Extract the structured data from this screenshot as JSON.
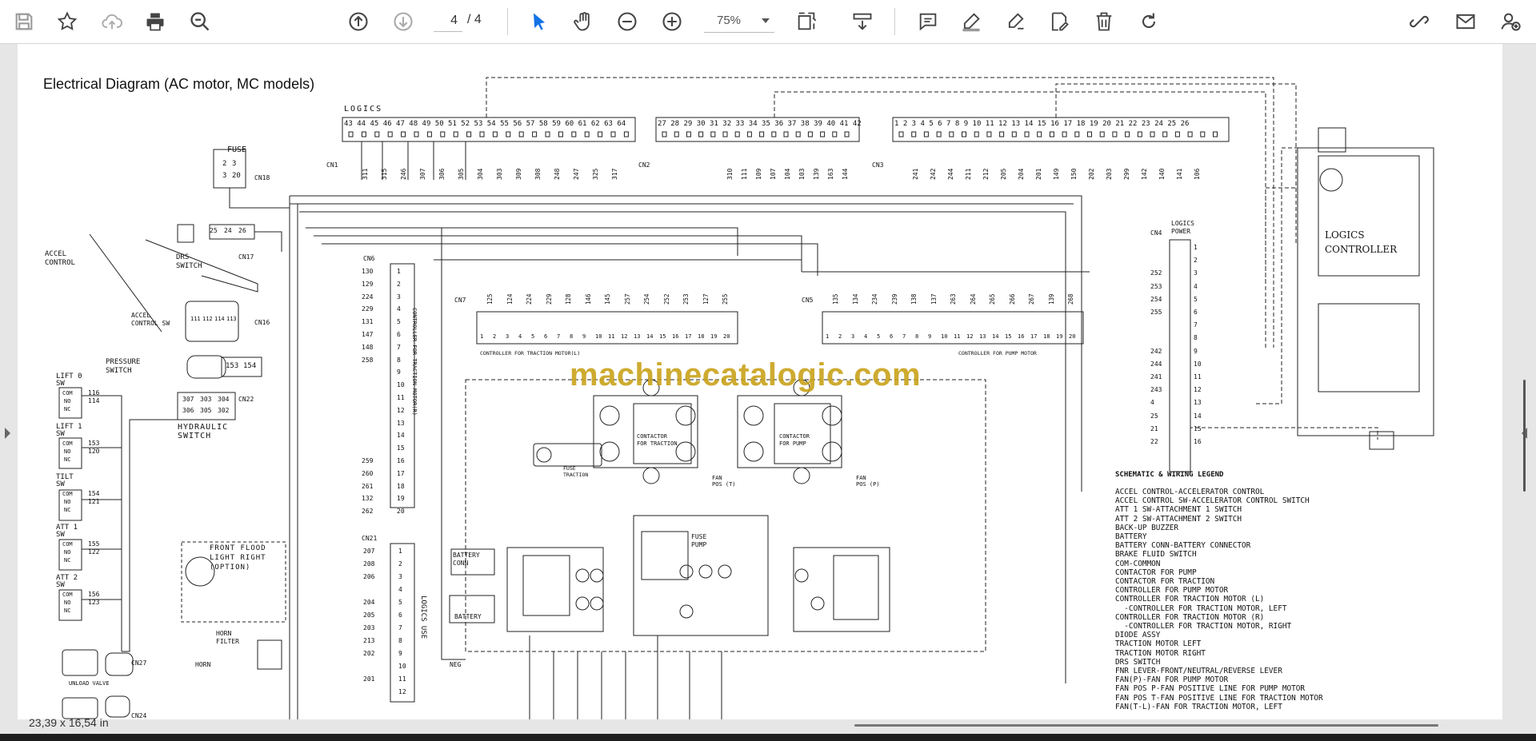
{
  "toolbar": {
    "icons": [
      "save-icon",
      "star-icon",
      "cloud-upload-icon",
      "print-icon",
      "zoom-search-icon",
      "page-up-icon",
      "page-down-icon",
      "select-arrow-icon",
      "hand-icon",
      "zoom-out-icon",
      "zoom-in-icon",
      "fit-page-icon",
      "scroll-mode-icon",
      "comment-icon",
      "highlight-icon",
      "sign-icon",
      "edit-pdf-icon",
      "delete-icon",
      "rotate-icon",
      "share-link-icon",
      "email-icon",
      "account-icon"
    ],
    "page_current": "4",
    "page_total": "/ 4",
    "zoom": "75%"
  },
  "status": {
    "dimensions": "23,39 x 16,54 in"
  },
  "document": {
    "title": "Electrical Diagram (AC motor, MC models)",
    "watermark": "machinecatalogic.com",
    "labels": {
      "logics": "LOGICS",
      "fuse": "FUSE",
      "cn18": "CN18",
      "cn1": "CN1",
      "cn2": "CN2",
      "cn3": "CN3",
      "cn4": "CN4",
      "logics_power": "LOGICS\nPOWER",
      "logics_controller": "LOGICS\nCONTROLLER",
      "accel_control": "ACCEL\nCONTROL",
      "drs_switch": "DRS\nSWITCH",
      "cn17": "CN17",
      "accel_control_sw": "ACCEL\nCONTROL SW",
      "cn16": "CN16",
      "pressure_switch": "PRESSURE\nSWITCH",
      "lift0": "LIFT 0\nSW",
      "lift1": "LIFT 1\nSW",
      "tilt": "TILT\nSW",
      "att1": "ATT 1\nSW",
      "att2": "ATT 2\nSW",
      "hydraulic_switch": "HYDRAULIC\nSWITCH",
      "cn22": "CN22",
      "cn6": "CN6",
      "cn7": "CN7",
      "cn5": "CN5",
      "cn21": "CN21",
      "ctrl_traction_right": "CONTROLLER FOR TRACTION MOTOR(R)",
      "ctrl_pump": "CONTROLLER FOR PUMP MOTOR",
      "ctrl_traction_left": "CONTROLLER FOR TRACTION MOTOR(L)",
      "logics_use": "LOGICS USE",
      "contactor_traction": "CONTACTOR\nFOR TRACTION",
      "contactor_pump": "CONTACTOR\nFOR PUMP",
      "fuse_traction": "FUSE\nTRACTION",
      "fan_pos_t": "FAN\nPOS (T)",
      "fan_pos_p": "FAN\nPOS (P)",
      "fuse_pump": "FUSE\nPUMP",
      "battery_conn": "BATTERY\nCONN",
      "battery": "BATTERY",
      "neg": "NEG",
      "front_flood": "FRONT FLOOD\nLIGHT RIGHT\n(OPTION)",
      "horn_filter": "HORN\nFILTER",
      "horn": "HORN",
      "unload_valve": "UNLOAD VALVE",
      "cn27": "CN27",
      "cn24": "CN24",
      "com": "COM",
      "no": "NO",
      "nc": "NC"
    },
    "pins_cn1": "43 44 45 46 47 48 49 50 51 52 53 54 55 56 57 58 59 60 61 62 63 64",
    "pins_cn2": "27 28 29 30 31 32 33 34 35 36 37 38 39 40 41 42",
    "pins_cn3": "1 2 3 4 5 6 7 8 9 10 11 12 13 14 15 16 17 18 19 20 21 22 23 24 25 26",
    "wires_cn1": [
      "311",
      "315",
      "246",
      "307",
      "306",
      "305",
      "304",
      "303",
      "309",
      "308",
      "248",
      "247",
      "325",
      "317"
    ],
    "wires_cn2": [
      "310",
      "111",
      "109",
      "107",
      "104",
      "103",
      "139",
      "163",
      "144"
    ],
    "wires_cn3": [
      "241",
      "242",
      "244",
      "211",
      "212",
      "205",
      "204",
      "201",
      "149",
      "150",
      "202",
      "203",
      "299",
      "142",
      "140",
      "141",
      "106"
    ],
    "cn6_wires": [
      "130",
      "129",
      "224",
      "229",
      "131",
      "147",
      "148",
      "258",
      "",
      "",
      "",
      "",
      "",
      "",
      "",
      "259",
      "260",
      "261",
      "132",
      "262"
    ],
    "cn21_wires": [
      "207",
      "208",
      "206",
      "",
      "204",
      "205",
      "203",
      "213",
      "202",
      "",
      "201",
      ""
    ],
    "cn4_wires": [
      "",
      "",
      "252",
      "253",
      "254",
      "255",
      "",
      "",
      "242",
      "244",
      "241",
      "243",
      "4",
      "25",
      "21",
      "22"
    ],
    "cn7_top": [
      "125",
      "124",
      "224",
      "229",
      "128",
      "146",
      "145",
      "257",
      "254",
      "252",
      "253",
      "127",
      "255"
    ],
    "cn5_top": [
      "135",
      "134",
      "234",
      "239",
      "138",
      "137",
      "263",
      "264",
      "265",
      "266",
      "267",
      "139",
      "268"
    ],
    "switch_wires": {
      "lift0": [
        "116",
        "114"
      ],
      "lift1": [
        "153",
        "120"
      ],
      "tilt": [
        "154",
        "121"
      ],
      "att1": [
        "155",
        "122"
      ],
      "att2": [
        "156",
        "123"
      ]
    },
    "hydraulic_pins": [
      "307",
      "303",
      "304",
      "306",
      "305",
      "302"
    ],
    "fuse_pins": [
      "2",
      "3",
      "3",
      "20"
    ],
    "cn16_pins": [
      "111",
      "112",
      "114",
      "113"
    ],
    "pressure_pins": [
      "153",
      "154"
    ],
    "drs_pins": [
      "25",
      "24",
      "26"
    ],
    "legend": {
      "title": "SCHEMATIC & WIRING LEGEND",
      "items": [
        "ACCEL CONTROL-ACCELERATOR CONTROL",
        "ACCEL CONTROL SW-ACCELERATOR CONTROL SWITCH",
        "ATT 1 SW-ATTACHMENT 1 SWITCH",
        "ATT 2 SW-ATTACHMENT 2 SWITCH",
        "BACK-UP BUZZER",
        "BATTERY",
        "BATTERY CONN-BATTERY CONNECTOR",
        "BRAKE FLUID SWITCH",
        "COM-COMMON",
        "CONTACTOR FOR PUMP",
        "CONTACTOR FOR TRACTION",
        "CONTROLLER FOR PUMP MOTOR",
        "CONTROLLER FOR TRACTION MOTOR (L)",
        "  -CONTROLLER FOR TRACTION MOTOR, LEFT",
        "CONTROLLER FOR TRACTION MOTOR (R)",
        "  -CONTROLLER FOR TRACTION MOTOR, RIGHT",
        "DIODE ASSY",
        "TRACTION MOTOR LEFT",
        "TRACTION MOTOR RIGHT",
        "DRS SWITCH",
        "FNR LEVER-FRONT/NEUTRAL/REVERSE LEVER",
        "FAN(P)-FAN FOR PUMP MOTOR",
        "FAN POS P-FAN POSITIVE LINE FOR PUMP MOTOR",
        "FAN POS T-FAN POSITIVE LINE FOR TRACTION MOTOR",
        "FAN(T-L)-FAN FOR TRACTION MOTOR, LEFT"
      ]
    }
  }
}
